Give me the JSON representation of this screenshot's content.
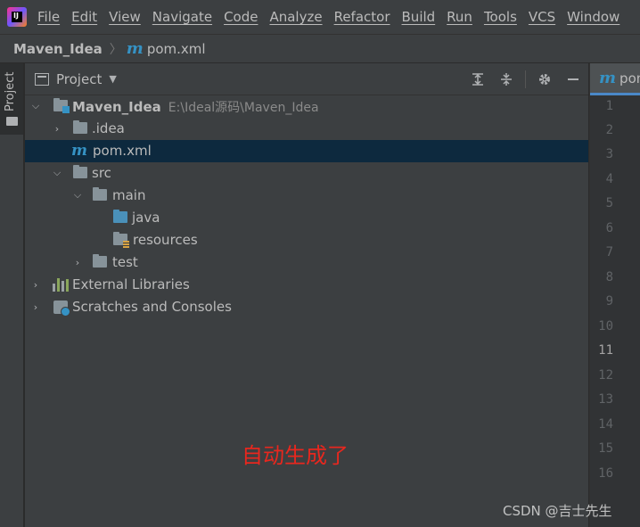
{
  "menu": {
    "items": [
      "File",
      "Edit",
      "View",
      "Navigate",
      "Code",
      "Analyze",
      "Refactor",
      "Build",
      "Run",
      "Tools",
      "VCS",
      "Window"
    ]
  },
  "breadcrumb": {
    "project": "Maven_Idea",
    "file": "pom.xml",
    "file_icon": "maven-m-icon"
  },
  "toolwindow_strip": {
    "label": "Project"
  },
  "project_panel": {
    "title": "Project",
    "header_icons": [
      "expand-all-icon",
      "collapse-all-icon",
      "gear-icon",
      "hide-icon"
    ],
    "tree": {
      "root_name": "Maven_Idea",
      "root_path": "E:\\Ideal源码\\Maven_Idea",
      "idea_folder": ".idea",
      "pom_file": "pom.xml",
      "src_folder": "src",
      "main_folder": "main",
      "java_folder": "java",
      "resources_folder": "resources",
      "test_folder": "test",
      "external_libraries": "External Libraries",
      "scratches": "Scratches and Consoles"
    }
  },
  "annotation": {
    "text": "自动生成了",
    "color": "#e8271e"
  },
  "editor": {
    "tab_label": "pom",
    "line_numbers": [
      "1",
      "2",
      "3",
      "4",
      "5",
      "6",
      "7",
      "8",
      "9",
      "10",
      "11",
      "12",
      "13",
      "14",
      "15",
      "16"
    ],
    "current_line": "11"
  },
  "watermark": {
    "text": "CSDN @吉士先生"
  },
  "colors": {
    "accent": "#3592c4",
    "selection": "#0d293e",
    "panel_bg": "#3c3f41",
    "editor_bg": "#2b2b2b"
  }
}
